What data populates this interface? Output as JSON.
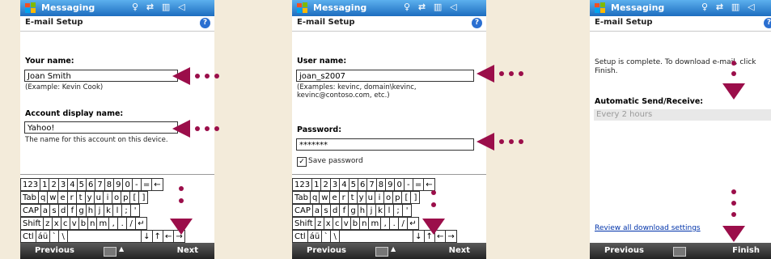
{
  "app_title": "Messaging",
  "page_header": "E-mail Setup",
  "help_icon": "?",
  "screen1": {
    "name_label": "Your name:",
    "name_value": "Joan Smith",
    "name_hint": "(Example: Kevin Cook)",
    "display_label": "Account display name:",
    "display_value": "Yahoo!",
    "display_hint": "The name for this account on this device.",
    "left_soft": "Previous",
    "right_soft": "Next"
  },
  "screen2": {
    "user_label": "User name:",
    "user_value": "joan_s2007",
    "user_hint_1": "(Examples: kevinc, domain\\kevinc,",
    "user_hint_2": "kevinc@contoso.com, etc.)",
    "password_label": "Password:",
    "password_value": "*******",
    "save_password": "Save password",
    "left_soft": "Previous",
    "right_soft": "Next"
  },
  "screen3": {
    "complete_text_1": "Setup is complete.  To download e-mail, click",
    "complete_text_2": "Finish.",
    "auto_label": "Automatic Send/Receive:",
    "auto_value": "Every 2 hours",
    "review_link": "Review all download settings",
    "left_soft": "Previous",
    "right_soft": "Finish"
  },
  "keyboard_rows": [
    [
      "123",
      "1",
      "2",
      "3",
      "4",
      "5",
      "6",
      "7",
      "8",
      "9",
      "0",
      "-",
      "=",
      "←"
    ],
    [
      "Tab",
      "q",
      "w",
      "e",
      "r",
      "t",
      "y",
      "u",
      "i",
      "o",
      "p",
      "[",
      "]"
    ],
    [
      "CAP",
      "a",
      "s",
      "d",
      "f",
      "g",
      "h",
      "j",
      "k",
      "l",
      ";",
      "'"
    ],
    [
      "Shift",
      "z",
      "x",
      "c",
      "v",
      "b",
      "n",
      "m",
      ",",
      ".",
      "/",
      "↵"
    ],
    [
      "Ctl",
      "áü",
      "`",
      "\\",
      "",
      "↓",
      "↑",
      "←",
      "→"
    ]
  ],
  "status_icons": "♀ ⇄ ▥ ◁",
  "accent_color": "#9b0e4a"
}
